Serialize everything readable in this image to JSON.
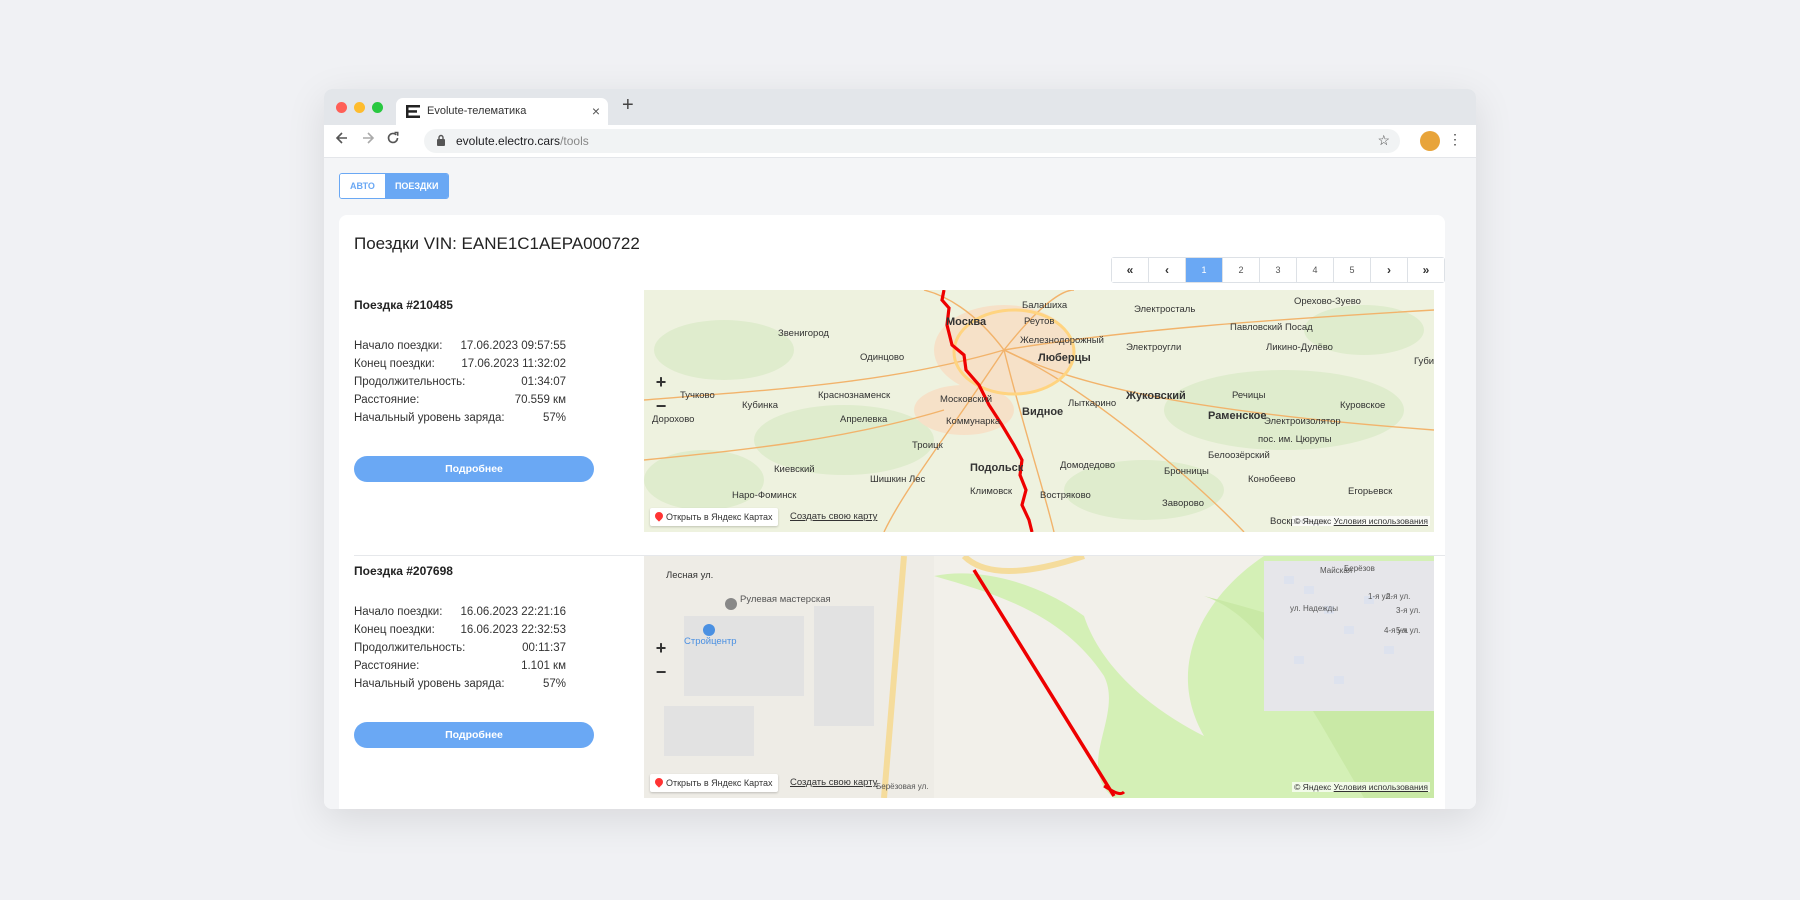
{
  "browser": {
    "tab_title": "Evolute-телематика",
    "close_symbol": "×",
    "new_tab_symbol": "+",
    "url_host": "evolute.electro.cars",
    "url_path": "/tools",
    "icons": [
      "back-arrow-icon",
      "forward-arrow-icon",
      "reload-icon",
      "lock-icon",
      "star-icon",
      "avatar",
      "menu-dots-icon"
    ]
  },
  "tabs": [
    "АВТО",
    "ПОЕЗДКИ"
  ],
  "active_tab": "ПОЕЗДКИ",
  "page_title": "Поездки VIN: EANE1C1AEPA000722",
  "pagination": {
    "first": "«",
    "prev": "‹",
    "pages": [
      "1",
      "2",
      "3",
      "4",
      "5"
    ],
    "next": "›",
    "last": "»",
    "active": "1"
  },
  "labels": {
    "start": "Начало поездки:",
    "end": "Конец поездки:",
    "duration": "Продолжительность:",
    "distance": "Расстояние:",
    "charge": "Начальный уровень заряда:",
    "details_button": "Подробнее"
  },
  "map_controls": {
    "zoom_in": "+",
    "zoom_out": "−",
    "open_yandex": "Открыть в Яндекс Картах",
    "create_map": "Создать свою карту",
    "copyright": "© Яндекс",
    "terms": "Условия использования"
  },
  "trips": [
    {
      "title": "Поездка #210485",
      "start": "17.06.2023 09:57:55",
      "end": "17.06.2023 11:32:02",
      "duration": "01:34:07",
      "distance": "70.559 км",
      "charge": "57%",
      "map_labels": [
        "Балашиха",
        "Реутов",
        "Москва",
        "Электросталь",
        "Орехово-Зуево",
        "Звенигород",
        "Железнодорожный",
        "Павловский Посад",
        "Одинцово",
        "Люберцы",
        "Электроугли",
        "Ликино-Дулёво",
        "Губино",
        "Тучково",
        "Краснознаменск",
        "Московский",
        "Кубинка",
        "Лыткарино",
        "Жуковский",
        "Речицы",
        "Раменское",
        "Куровское",
        "Дорохово",
        "Апрелевка",
        "Коммунарка",
        "Видное",
        "Электроизолятор",
        "пос. им. Цюрупы",
        "Троицк",
        "Белоозёрский",
        "Киевский",
        "Подольск",
        "Домодедово",
        "Бронницы",
        "Шишкин Лес",
        "Наро-Фоминск",
        "Климовск",
        "Востряково",
        "Конобеево",
        "Егорьевск",
        "Заворово",
        "Воскресенск"
      ]
    },
    {
      "title": "Поездка #207698",
      "start": "16.06.2023 22:21:16",
      "end": "16.06.2023 22:32:53",
      "duration": "00:11:37",
      "distance": "1.101 км",
      "charge": "57%",
      "map_labels": [
        "Лесная ул.",
        "Рулевая мастерская",
        "Стройцентр",
        "ул. Надежды",
        "Майская",
        "Берёзов",
        "1-я ул.",
        "2-я ул.",
        "3-я ул.",
        "4-я ул.",
        "5-я ул.",
        "Берёзовая ул."
      ]
    }
  ]
}
